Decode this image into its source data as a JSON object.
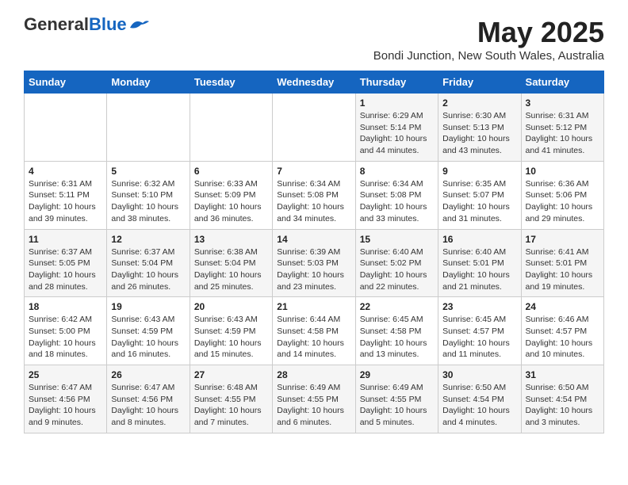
{
  "logo": {
    "general": "General",
    "blue": "Blue"
  },
  "title": "May 2025",
  "location": "Bondi Junction, New South Wales, Australia",
  "days_of_week": [
    "Sunday",
    "Monday",
    "Tuesday",
    "Wednesday",
    "Thursday",
    "Friday",
    "Saturday"
  ],
  "weeks": [
    [
      {
        "day": "",
        "info": ""
      },
      {
        "day": "",
        "info": ""
      },
      {
        "day": "",
        "info": ""
      },
      {
        "day": "",
        "info": ""
      },
      {
        "day": "1",
        "info": "Sunrise: 6:29 AM\nSunset: 5:14 PM\nDaylight: 10 hours\nand 44 minutes."
      },
      {
        "day": "2",
        "info": "Sunrise: 6:30 AM\nSunset: 5:13 PM\nDaylight: 10 hours\nand 43 minutes."
      },
      {
        "day": "3",
        "info": "Sunrise: 6:31 AM\nSunset: 5:12 PM\nDaylight: 10 hours\nand 41 minutes."
      }
    ],
    [
      {
        "day": "4",
        "info": "Sunrise: 6:31 AM\nSunset: 5:11 PM\nDaylight: 10 hours\nand 39 minutes."
      },
      {
        "day": "5",
        "info": "Sunrise: 6:32 AM\nSunset: 5:10 PM\nDaylight: 10 hours\nand 38 minutes."
      },
      {
        "day": "6",
        "info": "Sunrise: 6:33 AM\nSunset: 5:09 PM\nDaylight: 10 hours\nand 36 minutes."
      },
      {
        "day": "7",
        "info": "Sunrise: 6:34 AM\nSunset: 5:08 PM\nDaylight: 10 hours\nand 34 minutes."
      },
      {
        "day": "8",
        "info": "Sunrise: 6:34 AM\nSunset: 5:08 PM\nDaylight: 10 hours\nand 33 minutes."
      },
      {
        "day": "9",
        "info": "Sunrise: 6:35 AM\nSunset: 5:07 PM\nDaylight: 10 hours\nand 31 minutes."
      },
      {
        "day": "10",
        "info": "Sunrise: 6:36 AM\nSunset: 5:06 PM\nDaylight: 10 hours\nand 29 minutes."
      }
    ],
    [
      {
        "day": "11",
        "info": "Sunrise: 6:37 AM\nSunset: 5:05 PM\nDaylight: 10 hours\nand 28 minutes."
      },
      {
        "day": "12",
        "info": "Sunrise: 6:37 AM\nSunset: 5:04 PM\nDaylight: 10 hours\nand 26 minutes."
      },
      {
        "day": "13",
        "info": "Sunrise: 6:38 AM\nSunset: 5:04 PM\nDaylight: 10 hours\nand 25 minutes."
      },
      {
        "day": "14",
        "info": "Sunrise: 6:39 AM\nSunset: 5:03 PM\nDaylight: 10 hours\nand 23 minutes."
      },
      {
        "day": "15",
        "info": "Sunrise: 6:40 AM\nSunset: 5:02 PM\nDaylight: 10 hours\nand 22 minutes."
      },
      {
        "day": "16",
        "info": "Sunrise: 6:40 AM\nSunset: 5:01 PM\nDaylight: 10 hours\nand 21 minutes."
      },
      {
        "day": "17",
        "info": "Sunrise: 6:41 AM\nSunset: 5:01 PM\nDaylight: 10 hours\nand 19 minutes."
      }
    ],
    [
      {
        "day": "18",
        "info": "Sunrise: 6:42 AM\nSunset: 5:00 PM\nDaylight: 10 hours\nand 18 minutes."
      },
      {
        "day": "19",
        "info": "Sunrise: 6:43 AM\nSunset: 4:59 PM\nDaylight: 10 hours\nand 16 minutes."
      },
      {
        "day": "20",
        "info": "Sunrise: 6:43 AM\nSunset: 4:59 PM\nDaylight: 10 hours\nand 15 minutes."
      },
      {
        "day": "21",
        "info": "Sunrise: 6:44 AM\nSunset: 4:58 PM\nDaylight: 10 hours\nand 14 minutes."
      },
      {
        "day": "22",
        "info": "Sunrise: 6:45 AM\nSunset: 4:58 PM\nDaylight: 10 hours\nand 13 minutes."
      },
      {
        "day": "23",
        "info": "Sunrise: 6:45 AM\nSunset: 4:57 PM\nDaylight: 10 hours\nand 11 minutes."
      },
      {
        "day": "24",
        "info": "Sunrise: 6:46 AM\nSunset: 4:57 PM\nDaylight: 10 hours\nand 10 minutes."
      }
    ],
    [
      {
        "day": "25",
        "info": "Sunrise: 6:47 AM\nSunset: 4:56 PM\nDaylight: 10 hours\nand 9 minutes."
      },
      {
        "day": "26",
        "info": "Sunrise: 6:47 AM\nSunset: 4:56 PM\nDaylight: 10 hours\nand 8 minutes."
      },
      {
        "day": "27",
        "info": "Sunrise: 6:48 AM\nSunset: 4:55 PM\nDaylight: 10 hours\nand 7 minutes."
      },
      {
        "day": "28",
        "info": "Sunrise: 6:49 AM\nSunset: 4:55 PM\nDaylight: 10 hours\nand 6 minutes."
      },
      {
        "day": "29",
        "info": "Sunrise: 6:49 AM\nSunset: 4:55 PM\nDaylight: 10 hours\nand 5 minutes."
      },
      {
        "day": "30",
        "info": "Sunrise: 6:50 AM\nSunset: 4:54 PM\nDaylight: 10 hours\nand 4 minutes."
      },
      {
        "day": "31",
        "info": "Sunrise: 6:50 AM\nSunset: 4:54 PM\nDaylight: 10 hours\nand 3 minutes."
      }
    ]
  ]
}
